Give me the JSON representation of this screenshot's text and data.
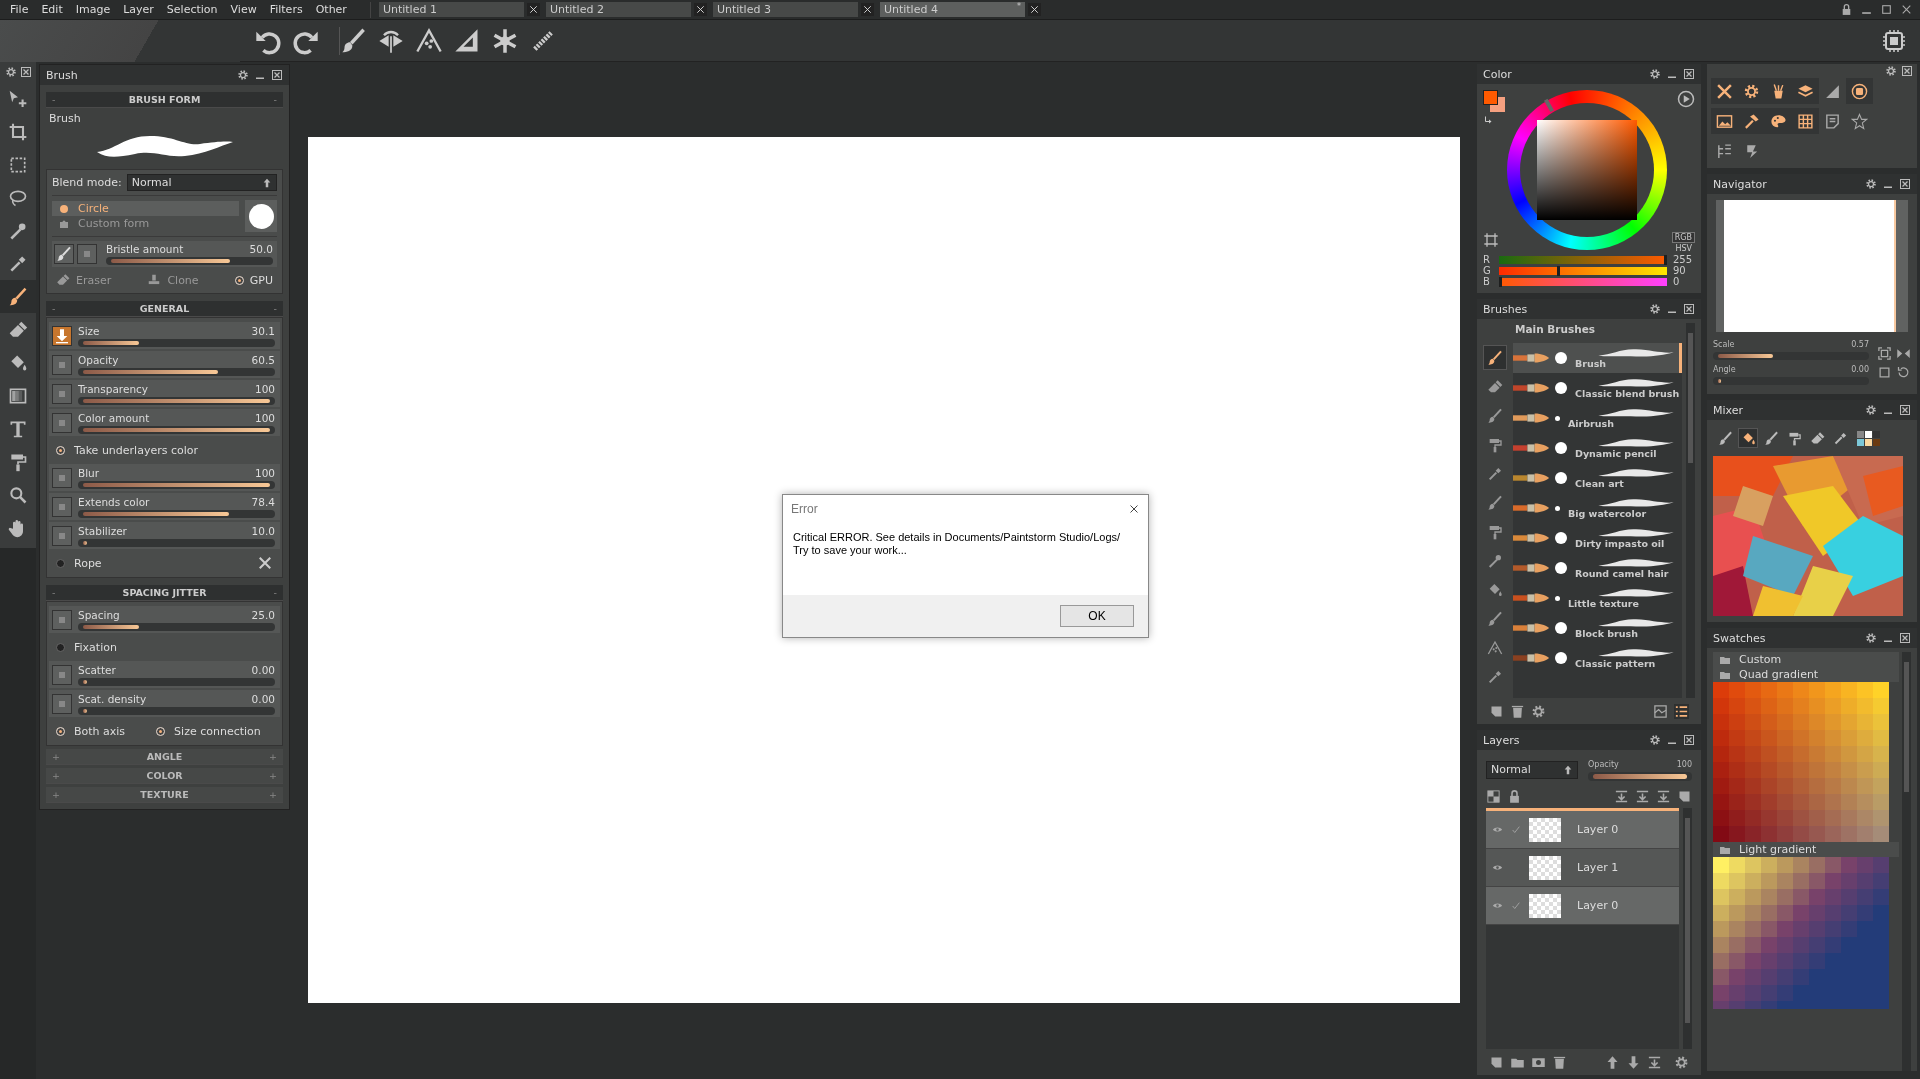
{
  "menu": [
    "File",
    "Edit",
    "Image",
    "Layer",
    "Selection",
    "View",
    "Filters",
    "Other"
  ],
  "tabs": [
    {
      "label": "Untitled 1",
      "selected": false
    },
    {
      "label": "Untitled 2",
      "selected": false
    },
    {
      "label": "Untitled 3",
      "selected": false
    },
    {
      "label": "Untitled 4",
      "selected": true,
      "mark": "*"
    }
  ],
  "tools": [
    {
      "kind": "move",
      "selected": false
    },
    {
      "kind": "crop",
      "selected": false
    },
    {
      "kind": "select",
      "selected": false
    },
    {
      "kind": "lasso",
      "selected": false
    },
    {
      "kind": "wand",
      "selected": false
    },
    {
      "kind": "picker",
      "selected": false
    },
    {
      "kind": "brush",
      "selected": true
    },
    {
      "kind": "eraser",
      "selected": false
    },
    {
      "kind": "bucket",
      "selected": false
    },
    {
      "kind": "gradient",
      "selected": false
    },
    {
      "kind": "typet",
      "selected": false
    },
    {
      "kind": "roller",
      "selected": false
    },
    {
      "kind": "zoom",
      "selected": false
    },
    {
      "kind": "hand",
      "selected": false
    }
  ],
  "brush_panel": {
    "title": "Brush",
    "form_header": {
      "signs": [
        "-",
        "-"
      ],
      "title": "BRUSH FORM"
    },
    "brush_name": "Brush",
    "blend_label": "Blend mode:",
    "blend_value": "Normal",
    "shapes": [
      {
        "label": "Circle",
        "selected": true
      },
      {
        "label": "Custom form",
        "selected": false
      }
    ],
    "bristle": {
      "label": "Bristle amount",
      "value": "50.0",
      "level": 0.76
    },
    "modes": [
      {
        "kind": "eraser",
        "label": "Eraser"
      },
      {
        "kind": "clone",
        "label": "Clone"
      },
      {
        "kind": "radio",
        "label": "GPU",
        "on": true
      }
    ],
    "sections": [
      {
        "title": "GENERAL",
        "signs": [
          "-",
          "-"
        ],
        "expanded": true,
        "rows": [
          {
            "kind": "slider",
            "label": "Size",
            "value": "30.1",
            "level": 0.3,
            "active": true
          },
          {
            "kind": "slider",
            "label": "Opacity",
            "value": "60.5",
            "level": 0.72,
            "active": false
          },
          {
            "kind": "slider",
            "label": "Transparency",
            "value": "100",
            "level": 1,
            "active": false
          },
          {
            "kind": "slider",
            "label": "Color amount",
            "value": "100",
            "level": 1,
            "active": false
          },
          {
            "kind": "option",
            "label": "Take underlayers color",
            "on": true
          },
          {
            "kind": "slider",
            "label": "Blur",
            "value": "100",
            "level": 1,
            "active": false
          },
          {
            "kind": "slider",
            "label": "Extends color",
            "value": "78.4",
            "level": 0.78,
            "active": false
          },
          {
            "kind": "slider",
            "label": "Stabilizer",
            "value": "10.0",
            "level": 0.02,
            "active": false
          },
          {
            "kind": "option_tool",
            "label": "Rope",
            "on": false
          }
        ]
      },
      {
        "title": "SPACING JITTER",
        "signs": [
          "-",
          "-"
        ],
        "expanded": true,
        "rows": [
          {
            "kind": "slider",
            "label": "Spacing",
            "value": "25.0",
            "level": 0.3,
            "active": false
          },
          {
            "kind": "option",
            "label": "Fixation",
            "on": false
          },
          {
            "kind": "slider",
            "label": "Scatter",
            "value": "0.00",
            "level": 0.01,
            "active": false
          },
          {
            "kind": "slider",
            "label": "Scat. density",
            "value": "0.00",
            "level": 0.01,
            "active": false
          },
          {
            "kind": "option_pair",
            "items": [
              {
                "label": "Both axis",
                "on": true
              },
              {
                "label": "Size connection",
                "on": true
              }
            ]
          }
        ]
      },
      {
        "title": "ANGLE",
        "signs": [
          "+",
          "+"
        ],
        "expanded": false
      },
      {
        "title": "COLOR",
        "signs": [
          "+",
          "+"
        ],
        "expanded": false
      },
      {
        "title": "TEXTURE",
        "signs": [
          "+",
          "+"
        ],
        "expanded": false
      }
    ]
  },
  "dialog": {
    "title": "Error",
    "message": "Critical ERROR. See details in Documents/Paintstorm Studio/Logs/\n Try to save your work...",
    "button": "OK"
  },
  "color_panel": {
    "title": "Color",
    "modes": [
      {
        "label": "RGB",
        "selected": true
      },
      {
        "label": "HSV",
        "selected": false
      }
    ],
    "channels": [
      {
        "name": "R",
        "value": "255",
        "level": 1
      },
      {
        "name": "G",
        "value": "90",
        "level": 0.35
      },
      {
        "name": "B",
        "value": "0",
        "level": 0
      }
    ]
  },
  "brushes_panel": {
    "title": "Brushes",
    "group": "Main Brushes",
    "categories": [
      {
        "selected": true
      },
      {
        "selected": false
      },
      {
        "selected": false
      },
      {
        "selected": false
      },
      {
        "selected": false
      },
      {
        "selected": false
      },
      {
        "selected": false
      },
      {
        "selected": false
      },
      {
        "selected": false
      },
      {
        "selected": false
      },
      {
        "selected": false
      },
      {
        "selected": false
      }
    ],
    "items": [
      {
        "label": "Brush",
        "selected": true
      },
      {
        "label": "Classic blend brush",
        "selected": false
      },
      {
        "label": "Airbrush",
        "selected": false
      },
      {
        "label": "Dynamic pencil",
        "selected": false
      },
      {
        "label": "Clean art",
        "selected": false
      },
      {
        "label": "Big watercolor",
        "selected": false
      },
      {
        "label": "Dirty impasto oil",
        "selected": false
      },
      {
        "label": "Round camel hair",
        "selected": false
      },
      {
        "label": "Little texture",
        "selected": false
      },
      {
        "label": "Block brush",
        "selected": false
      },
      {
        "label": "Classic pattern",
        "selected": false
      }
    ]
  },
  "layers_panel": {
    "title": "Layers",
    "blend": "Normal",
    "opacity_label": "Opacity",
    "opacity_value": "100",
    "level": 1,
    "rows": [
      {
        "name": "Layer 0",
        "visible": true,
        "checked": true,
        "selected": true
      },
      {
        "name": "Layer 1",
        "visible": true,
        "checked": false,
        "selected": false
      },
      {
        "name": "Layer 0",
        "visible": true,
        "checked": true,
        "selected": true
      }
    ]
  },
  "navigator": {
    "title": "Navigator",
    "sliders": [
      {
        "label": "Scale",
        "value": "0.57",
        "level": 0.38
      },
      {
        "label": "Angle",
        "value": "0.00",
        "level": 0.01
      }
    ]
  },
  "mixer": {
    "title": "Mixer",
    "tools": [
      {
        "selected": false
      },
      {
        "selected": true
      },
      {
        "selected": false
      },
      {
        "selected": false
      },
      {
        "selected": false
      },
      {
        "selected": false
      }
    ]
  },
  "swatches": {
    "title": "Swatches",
    "groups": [
      {
        "kind": "folder",
        "name": "Custom"
      },
      {
        "kind": "quad",
        "name": "Quad gradient"
      },
      {
        "kind": "light",
        "name": "Light gradient"
      }
    ]
  }
}
